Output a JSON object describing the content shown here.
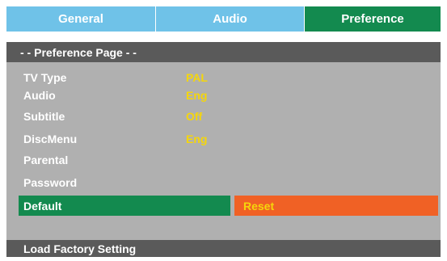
{
  "tabs": [
    {
      "label": "General"
    },
    {
      "label": "Audio"
    },
    {
      "label": "Preference"
    }
  ],
  "colors": {
    "tab_inactive": "#6fc2e8",
    "tab_active": "#138a4f",
    "header_bg": "#5a5a5a",
    "body_bg": "#b0b0b0",
    "value_text": "#f5d60b",
    "default_bg": "#138a4f",
    "reset_bg": "#f06125"
  },
  "page": {
    "title": "- -  Preference Page - -"
  },
  "settings": [
    {
      "label": "TV Type",
      "value": "PAL"
    },
    {
      "label": "Audio",
      "value": "Eng"
    },
    {
      "label": "Subtitle",
      "value": "Off"
    },
    {
      "label": "DiscMenu",
      "value": "Eng"
    },
    {
      "label": "Parental",
      "value": ""
    },
    {
      "label": "Password",
      "value": ""
    }
  ],
  "default_row": {
    "label": "Default",
    "option": "Reset"
  },
  "footer": {
    "text": "Load Factory Setting"
  }
}
